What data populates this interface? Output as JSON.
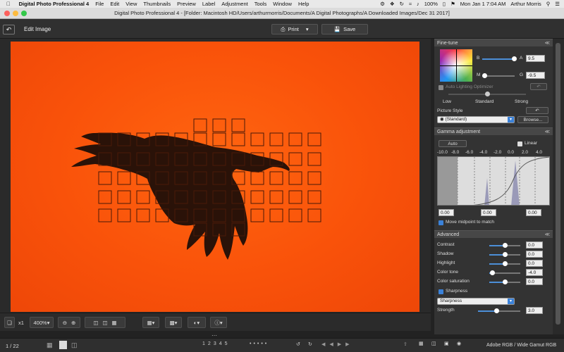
{
  "menubar": {
    "app": "Digital Photo Professional 4",
    "items": [
      "File",
      "Edit",
      "View",
      "Thumbnails",
      "Preview",
      "Label",
      "Adjustment",
      "Tools",
      "Window",
      "Help"
    ],
    "battery": "100%",
    "clock": "Mon Jan 1  7:04 AM",
    "user": "Arthur Morris"
  },
  "window": {
    "title": "Digital Photo Professional 4 - [Folder: Macintosh HD/Users/arthurmorris/Documents/A Digital Photographs/A Downloaded Images/Dec 31 2017]"
  },
  "toolbar": {
    "mode": "Edit Image",
    "print": "Print",
    "save": "Save"
  },
  "viewer": {
    "zoom_factor": "x1",
    "zoom": "400%"
  },
  "status": {
    "count": "1 / 22",
    "nums": [
      "1",
      "2",
      "3",
      "4",
      "5"
    ],
    "colorspace": "Adobe RGB / Wide Gamut RGB"
  },
  "finetune": {
    "header": "Fine-tune",
    "b_label": "B",
    "a_label": "A",
    "a_value": "9.5",
    "m_label": "M",
    "g_label": "G",
    "g_value": "-9.5",
    "alo": "Auto Lighting Optimizer",
    "low": "Low",
    "standard": "Standard",
    "strong": "Strong",
    "picture_style_label": "Picture Style",
    "picture_style": "(Standard)",
    "browse": "Browse..."
  },
  "gamma": {
    "header": "Gamma adjustment",
    "auto": "Auto",
    "linear": "Linear",
    "ticks": [
      "-10.0",
      "-8.0",
      "-6.0",
      "-4.0",
      "-2.0",
      "0.0",
      "2.0",
      "4.0"
    ],
    "val1": "0.00",
    "val2": "0.00",
    "val3": "0.00",
    "midpoint": "Move midpoint to match"
  },
  "advanced": {
    "header": "Advanced",
    "rows": [
      {
        "label": "Contrast",
        "value": "0.0",
        "level": 0.5
      },
      {
        "label": "Shadow",
        "value": "0.0",
        "level": 0.5
      },
      {
        "label": "Highlight",
        "value": "0.0",
        "level": 0.5
      },
      {
        "label": "Color tone",
        "value": "-4.0",
        "level": 0.1
      },
      {
        "label": "Color saturation",
        "value": "0.0",
        "level": 0.5
      }
    ],
    "sharpness_check": "Sharpness",
    "sharpness_select": "Sharpness",
    "strength_label": "Strength",
    "strength_value": "3.0",
    "strength_level": 0.43
  },
  "colors": {
    "accent": "#3b82d9",
    "sky": "#f9520a"
  }
}
